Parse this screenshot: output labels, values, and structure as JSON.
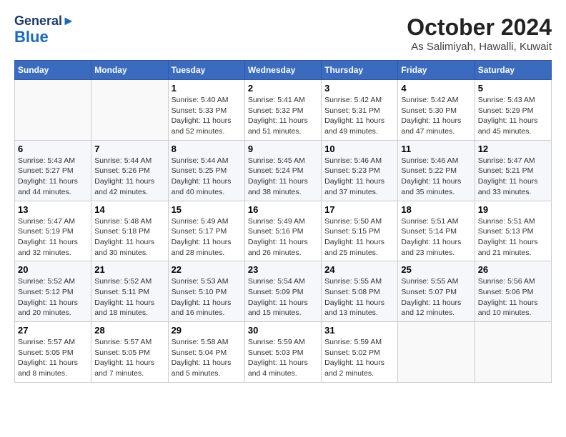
{
  "header": {
    "logo_general": "General",
    "logo_blue": "Blue",
    "month_title": "October 2024",
    "location": "As Salimiyah, Hawalli, Kuwait"
  },
  "weekdays": [
    "Sunday",
    "Monday",
    "Tuesday",
    "Wednesday",
    "Thursday",
    "Friday",
    "Saturday"
  ],
  "weeks": [
    [
      null,
      null,
      {
        "day": "1",
        "sunrise": "5:40 AM",
        "sunset": "5:33 PM",
        "daylight": "11 hours and 52 minutes."
      },
      {
        "day": "2",
        "sunrise": "5:41 AM",
        "sunset": "5:32 PM",
        "daylight": "11 hours and 51 minutes."
      },
      {
        "day": "3",
        "sunrise": "5:42 AM",
        "sunset": "5:31 PM",
        "daylight": "11 hours and 49 minutes."
      },
      {
        "day": "4",
        "sunrise": "5:42 AM",
        "sunset": "5:30 PM",
        "daylight": "11 hours and 47 minutes."
      },
      {
        "day": "5",
        "sunrise": "5:43 AM",
        "sunset": "5:29 PM",
        "daylight": "11 hours and 45 minutes."
      }
    ],
    [
      {
        "day": "6",
        "sunrise": "5:43 AM",
        "sunset": "5:27 PM",
        "daylight": "11 hours and 44 minutes."
      },
      {
        "day": "7",
        "sunrise": "5:44 AM",
        "sunset": "5:26 PM",
        "daylight": "11 hours and 42 minutes."
      },
      {
        "day": "8",
        "sunrise": "5:44 AM",
        "sunset": "5:25 PM",
        "daylight": "11 hours and 40 minutes."
      },
      {
        "day": "9",
        "sunrise": "5:45 AM",
        "sunset": "5:24 PM",
        "daylight": "11 hours and 38 minutes."
      },
      {
        "day": "10",
        "sunrise": "5:46 AM",
        "sunset": "5:23 PM",
        "daylight": "11 hours and 37 minutes."
      },
      {
        "day": "11",
        "sunrise": "5:46 AM",
        "sunset": "5:22 PM",
        "daylight": "11 hours and 35 minutes."
      },
      {
        "day": "12",
        "sunrise": "5:47 AM",
        "sunset": "5:21 PM",
        "daylight": "11 hours and 33 minutes."
      }
    ],
    [
      {
        "day": "13",
        "sunrise": "5:47 AM",
        "sunset": "5:19 PM",
        "daylight": "11 hours and 32 minutes."
      },
      {
        "day": "14",
        "sunrise": "5:48 AM",
        "sunset": "5:18 PM",
        "daylight": "11 hours and 30 minutes."
      },
      {
        "day": "15",
        "sunrise": "5:49 AM",
        "sunset": "5:17 PM",
        "daylight": "11 hours and 28 minutes."
      },
      {
        "day": "16",
        "sunrise": "5:49 AM",
        "sunset": "5:16 PM",
        "daylight": "11 hours and 26 minutes."
      },
      {
        "day": "17",
        "sunrise": "5:50 AM",
        "sunset": "5:15 PM",
        "daylight": "11 hours and 25 minutes."
      },
      {
        "day": "18",
        "sunrise": "5:51 AM",
        "sunset": "5:14 PM",
        "daylight": "11 hours and 23 minutes."
      },
      {
        "day": "19",
        "sunrise": "5:51 AM",
        "sunset": "5:13 PM",
        "daylight": "11 hours and 21 minutes."
      }
    ],
    [
      {
        "day": "20",
        "sunrise": "5:52 AM",
        "sunset": "5:12 PM",
        "daylight": "11 hours and 20 minutes."
      },
      {
        "day": "21",
        "sunrise": "5:52 AM",
        "sunset": "5:11 PM",
        "daylight": "11 hours and 18 minutes."
      },
      {
        "day": "22",
        "sunrise": "5:53 AM",
        "sunset": "5:10 PM",
        "daylight": "11 hours and 16 minutes."
      },
      {
        "day": "23",
        "sunrise": "5:54 AM",
        "sunset": "5:09 PM",
        "daylight": "11 hours and 15 minutes."
      },
      {
        "day": "24",
        "sunrise": "5:55 AM",
        "sunset": "5:08 PM",
        "daylight": "11 hours and 13 minutes."
      },
      {
        "day": "25",
        "sunrise": "5:55 AM",
        "sunset": "5:07 PM",
        "daylight": "11 hours and 12 minutes."
      },
      {
        "day": "26",
        "sunrise": "5:56 AM",
        "sunset": "5:06 PM",
        "daylight": "11 hours and 10 minutes."
      }
    ],
    [
      {
        "day": "27",
        "sunrise": "5:57 AM",
        "sunset": "5:05 PM",
        "daylight": "11 hours and 8 minutes."
      },
      {
        "day": "28",
        "sunrise": "5:57 AM",
        "sunset": "5:05 PM",
        "daylight": "11 hours and 7 minutes."
      },
      {
        "day": "29",
        "sunrise": "5:58 AM",
        "sunset": "5:04 PM",
        "daylight": "11 hours and 5 minutes."
      },
      {
        "day": "30",
        "sunrise": "5:59 AM",
        "sunset": "5:03 PM",
        "daylight": "11 hours and 4 minutes."
      },
      {
        "day": "31",
        "sunrise": "5:59 AM",
        "sunset": "5:02 PM",
        "daylight": "11 hours and 2 minutes."
      },
      null,
      null
    ]
  ]
}
